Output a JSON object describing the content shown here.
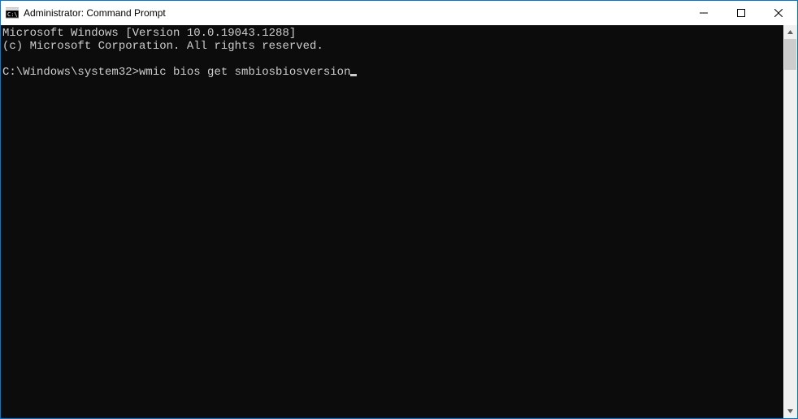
{
  "window": {
    "title": "Administrator: Command Prompt"
  },
  "terminal": {
    "line1": "Microsoft Windows [Version 10.0.19043.1288]",
    "line2": "(c) Microsoft Corporation. All rights reserved.",
    "blank": "",
    "prompt": "C:\\Windows\\system32>",
    "command": "wmic bios get smbiosbiosversion"
  },
  "icons": {
    "app": "cmd-icon",
    "minimize": "minimize-icon",
    "maximize": "maximize-icon",
    "close": "close-icon",
    "scroll_up": "chevron-up-icon",
    "scroll_down": "chevron-down-icon"
  }
}
